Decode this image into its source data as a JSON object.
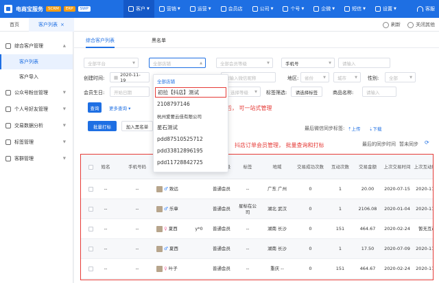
{
  "topbar": {
    "brand": "电商宝服务",
    "badges": [
      "SCRM",
      "ERP",
      "SWP"
    ],
    "nav": [
      {
        "label": "客户",
        "active": true
      },
      {
        "label": "营销",
        "active": false
      },
      {
        "label": "运营",
        "active": false
      },
      {
        "label": "会员店",
        "active": false
      },
      {
        "label": "公司",
        "active": false
      },
      {
        "label": "个号",
        "active": false
      },
      {
        "label": "企微",
        "active": false
      },
      {
        "label": "短信",
        "active": false
      },
      {
        "label": "设置",
        "active": false
      }
    ],
    "service": "客服"
  },
  "tabbar": {
    "home": "首页",
    "current": "客户列表",
    "refresh": "刷新",
    "close_others": "关闭其他"
  },
  "sidebar": {
    "groups": [
      {
        "label": "综合客户管理",
        "subs": [
          {
            "label": "客户列表",
            "active": true
          },
          {
            "label": "客户导入",
            "active": false
          }
        ]
      },
      {
        "label": "公众号粉丝管理",
        "subs": []
      },
      {
        "label": "个人号好友管理",
        "subs": []
      },
      {
        "label": "交易数据分析",
        "subs": []
      },
      {
        "label": "标签管理",
        "subs": []
      },
      {
        "label": "客群管理",
        "subs": []
      }
    ]
  },
  "main": {
    "subtabs": [
      "综合客户列表",
      "黑名单"
    ],
    "filters": {
      "platform": "全部平台",
      "shop": "全部店铺",
      "member_level": "全部会员等级",
      "phone_type": "手机号",
      "phone_placeholder": "请输入",
      "created_label": "创建时间:",
      "created_start": "2020-11-19",
      "id_placeholder": "请输入微信昵称",
      "region_label": "地区:",
      "province": "省份",
      "city": "城市",
      "gender_label": "性别:",
      "gender": "全部",
      "birthday_label": "会员生日:",
      "birthday_start": "开始日期",
      "tag_level": "选择等级",
      "tag_filter_label": "标签筛选:",
      "tag_button": "请选择标签",
      "product_label": "商品名称:",
      "product_placeholder": "请输入"
    },
    "search_button": "查询",
    "more_filters": "更多查询",
    "batch_tag": "批量打标",
    "add_blacklist": "加入黑名单",
    "last_sync_label": "最后微信同步标签:",
    "upload": "上传",
    "download": "下载",
    "last_sync_time": "最后的同步时间",
    "sync_none": "暂未同步",
    "annotations": {
      "one_stop": "抖店绑定后， 可一站式管理",
      "order_member": "抖店订单会员管理， 批量查询和打标"
    },
    "shop_dropdown": {
      "header": "全部店铺",
      "items": [
        "初拉【抖店】测试",
        "2108797146",
        "杭州爱要云佳有限公司",
        "星石测试",
        "pdd87510525712",
        "pdd33812896195",
        "pdd11728842725"
      ],
      "boxed_index": 0
    },
    "table": {
      "headers": [
        "姓名",
        "手机号码",
        "昵称",
        "会员等级",
        "标签",
        "地域",
        "交易成功次数",
        "互动次数",
        "交易金额",
        "上次交易时间",
        "上次互动时间"
      ],
      "rows": [
        {
          "name": "--",
          "phone": "--",
          "gender": "♂",
          "nick": "致远",
          "level": "普通会员",
          "tag": "--",
          "region": "广东 广州",
          "deals": "0",
          "interactions": "1",
          "amount": "20.00",
          "last_trade": "2020-07-15",
          "last_interact": "2020-11-2"
        },
        {
          "name": "--",
          "phone": "--",
          "gender": "♂",
          "nick": "乐章",
          "level": "普通会员",
          "tag": "星标在公司",
          "region": "湖北 武汉",
          "deals": "0",
          "interactions": "1",
          "amount": "2106.08",
          "last_trade": "2020-01-04",
          "last_interact": "2020-11-2"
        },
        {
          "name": "--",
          "phone": "--",
          "gender": "♀",
          "nick": "夏西",
          "extra": "y*0",
          "level": "普通会员",
          "tag": "--",
          "region": "湖南 长沙",
          "deals": "0",
          "interactions": "151",
          "amount": "464.67",
          "last_trade": "2020-02-24",
          "last_interact": "暂无互动"
        },
        {
          "name": "--",
          "phone": "--",
          "gender": "♂",
          "nick": "夏西",
          "level": "普通会员",
          "tag": "--",
          "region": "湖南 长沙",
          "deals": "0",
          "interactions": "1",
          "amount": "17.50",
          "last_trade": "2020-07-09",
          "last_interact": "2020-11-2"
        },
        {
          "name": "--",
          "phone": "--",
          "gender": "♀",
          "nick": "叶子",
          "level": "普通会员",
          "tag": "--",
          "region": "重庆 --",
          "deals": "0",
          "interactions": "151",
          "amount": "464.67",
          "last_trade": "2020-02-24",
          "last_interact": "2020-11-2"
        }
      ]
    }
  }
}
